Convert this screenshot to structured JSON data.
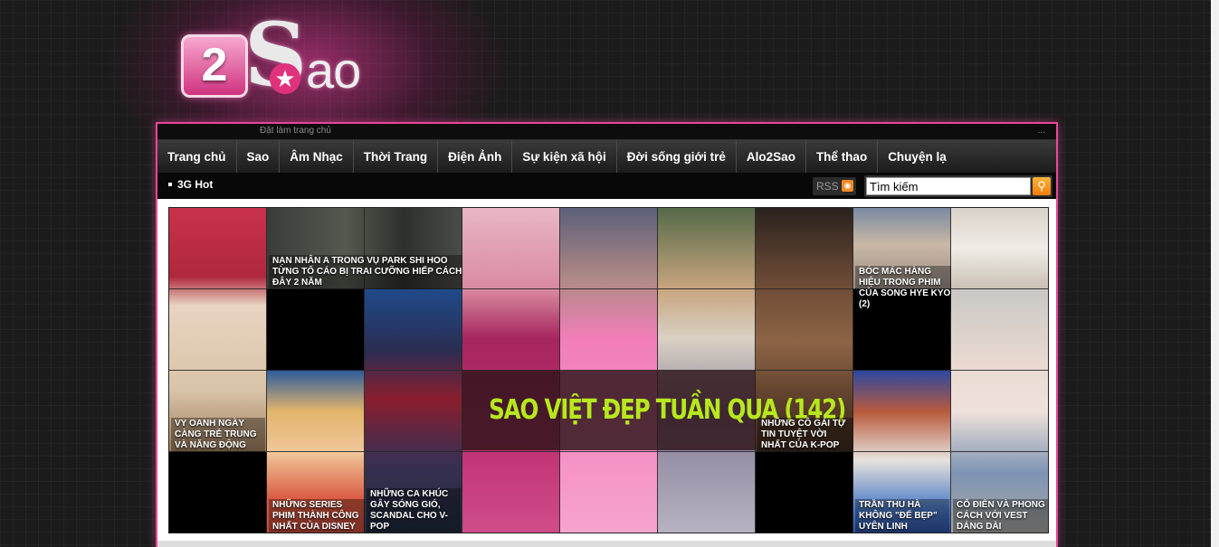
{
  "logo": {
    "digit": "2",
    "text_s": "S",
    "text_ao": "ao",
    "star": "★"
  },
  "topbar": {
    "link": "Đặt làm trang chủ",
    "dots": "..."
  },
  "nav": {
    "items": [
      {
        "label": "Trang chủ"
      },
      {
        "label": "Sao"
      },
      {
        "label": "Âm Nhạc"
      },
      {
        "label": "Thời Trang"
      },
      {
        "label": "Điện Ảnh"
      },
      {
        "label": "Sự kiện xã hội"
      },
      {
        "label": "Đời sống giới trẻ"
      },
      {
        "label": "Alo2Sao"
      },
      {
        "label": "Thể thao"
      },
      {
        "label": "Chuyện lạ"
      }
    ]
  },
  "subbar": {
    "hot_label": "3G Hot",
    "rss_label": "RSS"
  },
  "search": {
    "value": "Tìm kiếm",
    "button_icon": "search-icon"
  },
  "feature": {
    "title": "SAO VIỆT ĐẸP TUẦN QUA (142)"
  },
  "captions": {
    "c1": "NẠN NHÂN A TRONG VỤ PARK SHI HOO TỪNG TỐ CÁO BỊ TRAI CƯỠNG HIẾP CÁCH ĐÂY 2 NĂM",
    "c2": "BÓC MÁC HÀNG HIỆU TRONG PHIM CỦA SONG HYE KYO (2)",
    "c3": "VY OANH NGÀY CÀNG TRẺ TRUNG VÀ NĂNG ĐỘNG",
    "c4": "NHỮNG CÔ GÁI TỰ TIN TUYỆT VỜI NHẤT CỦA K-POP",
    "c5": "NHỮNG SERIES PHIM THÀNH CÔNG NHẤT CỦA DISNEY",
    "c6": "NHỮNG CA KHÚC GÂY SÓNG GIÓ, SCANDAL CHO V-POP",
    "c7": "TRẦN THU HÀ KHÔNG \"ĐỂ BẸP\" UYÊN LINH",
    "c8": "CỔ ĐIỂN VÀ PHONG CÁCH VỚI VEST DÁNG DÀI"
  },
  "colors": {
    "accent": "#e8479a",
    "feature_title": "#b6e81e",
    "rss": "#f08a24"
  }
}
